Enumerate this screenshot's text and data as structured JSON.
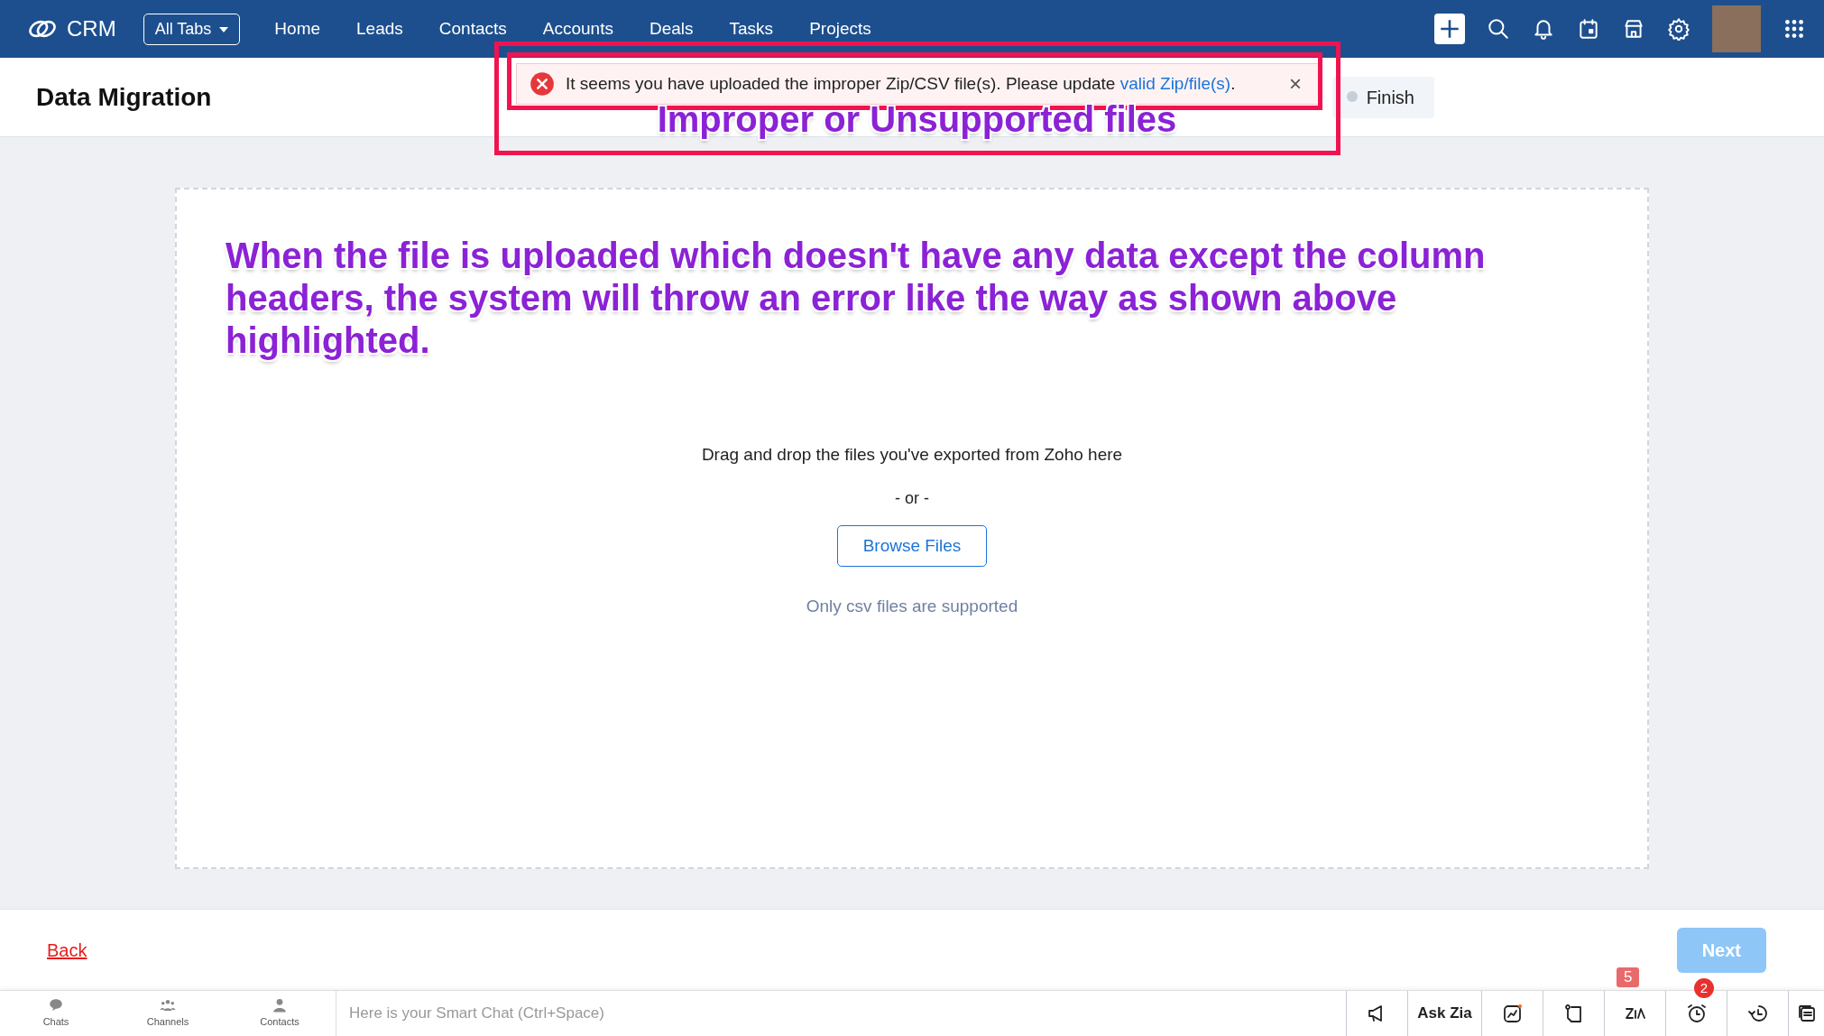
{
  "nav": {
    "logo": "CRM",
    "all_tabs": "All Tabs",
    "tabs": [
      "Home",
      "Leads",
      "Contacts",
      "Accounts",
      "Deals",
      "Tasks",
      "Projects"
    ]
  },
  "header": {
    "title": "Data Migration",
    "steps": [
      {
        "label": "Finish"
      }
    ]
  },
  "toast": {
    "message": "It seems you have uploaded the improper Zip/CSV file(s). Please update ",
    "link": "valid Zip/file(s)",
    "tail": ".",
    "close": "×"
  },
  "upload": {
    "instruction": "Drag and drop the files you've exported from Zoho here",
    "separator": "- or -",
    "button": "Browse Files",
    "note": "Only csv files are supported"
  },
  "annotations": [
    {
      "kind": "callout",
      "text": "Improper or Unsupported files"
    },
    {
      "kind": "note",
      "text": "When the file is uploaded which doesn't have any data except the column headers, the system will throw an error like the way as shown above highlighted."
    }
  ],
  "footer": {
    "back": "Back",
    "next": "Next",
    "next_disabled": true
  },
  "chat_bar": {
    "tabs": [
      {
        "kind": "chats",
        "label": "Chats"
      },
      {
        "kind": "channels",
        "label": "Channels"
      },
      {
        "kind": "contacts",
        "label": "Contacts"
      }
    ],
    "placeholder": "Here is your Smart Chat (Ctrl+Space)",
    "tools": [
      {
        "kind": "megaphone"
      },
      {
        "kind": "text",
        "label": "Ask Zia"
      },
      {
        "kind": "chart"
      },
      {
        "kind": "note"
      },
      {
        "kind": "zia",
        "badge": "5"
      },
      {
        "kind": "alarm",
        "badge": "2"
      },
      {
        "kind": "history"
      },
      {
        "kind": "cards"
      }
    ]
  }
}
